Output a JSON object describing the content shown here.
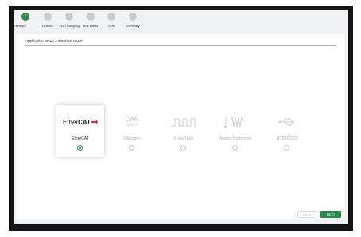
{
  "steps": [
    {
      "number": "1",
      "label": "Interface",
      "active": true
    },
    {
      "number": "",
      "label": "Options",
      "active": false
    },
    {
      "number": "",
      "label": "PDO Mapping",
      "active": false
    },
    {
      "number": "",
      "label": "Bus Limits",
      "active": false
    },
    {
      "number": "",
      "label": "I/Os",
      "active": false
    },
    {
      "number": "",
      "label": "Summary",
      "active": false
    }
  ],
  "breadcrumb": "Application Setup > Interface Mode",
  "interface_options": [
    {
      "label": "EtherCAT",
      "icon": "ethercat-logo",
      "selected": true
    },
    {
      "label": "CANopen",
      "icon": "canopen-logo",
      "selected": false
    },
    {
      "label": "Pulse Train",
      "icon": "pulse-train-icon",
      "selected": false
    },
    {
      "label": "Analog Command",
      "icon": "analog-signal-icon",
      "selected": false
    },
    {
      "label": "USB/RS232",
      "icon": "usb-icon",
      "selected": false
    }
  ],
  "logos": {
    "ethercat_prefix": "Ether",
    "ethercat_bold": "CAT",
    "canopen_top": "CAN",
    "canopen_bottom": "open"
  },
  "buttons": {
    "back": "BACK",
    "next": "NEXT"
  },
  "colors": {
    "accent": "#2e8a4a",
    "inactive": "#c8ccd0"
  }
}
